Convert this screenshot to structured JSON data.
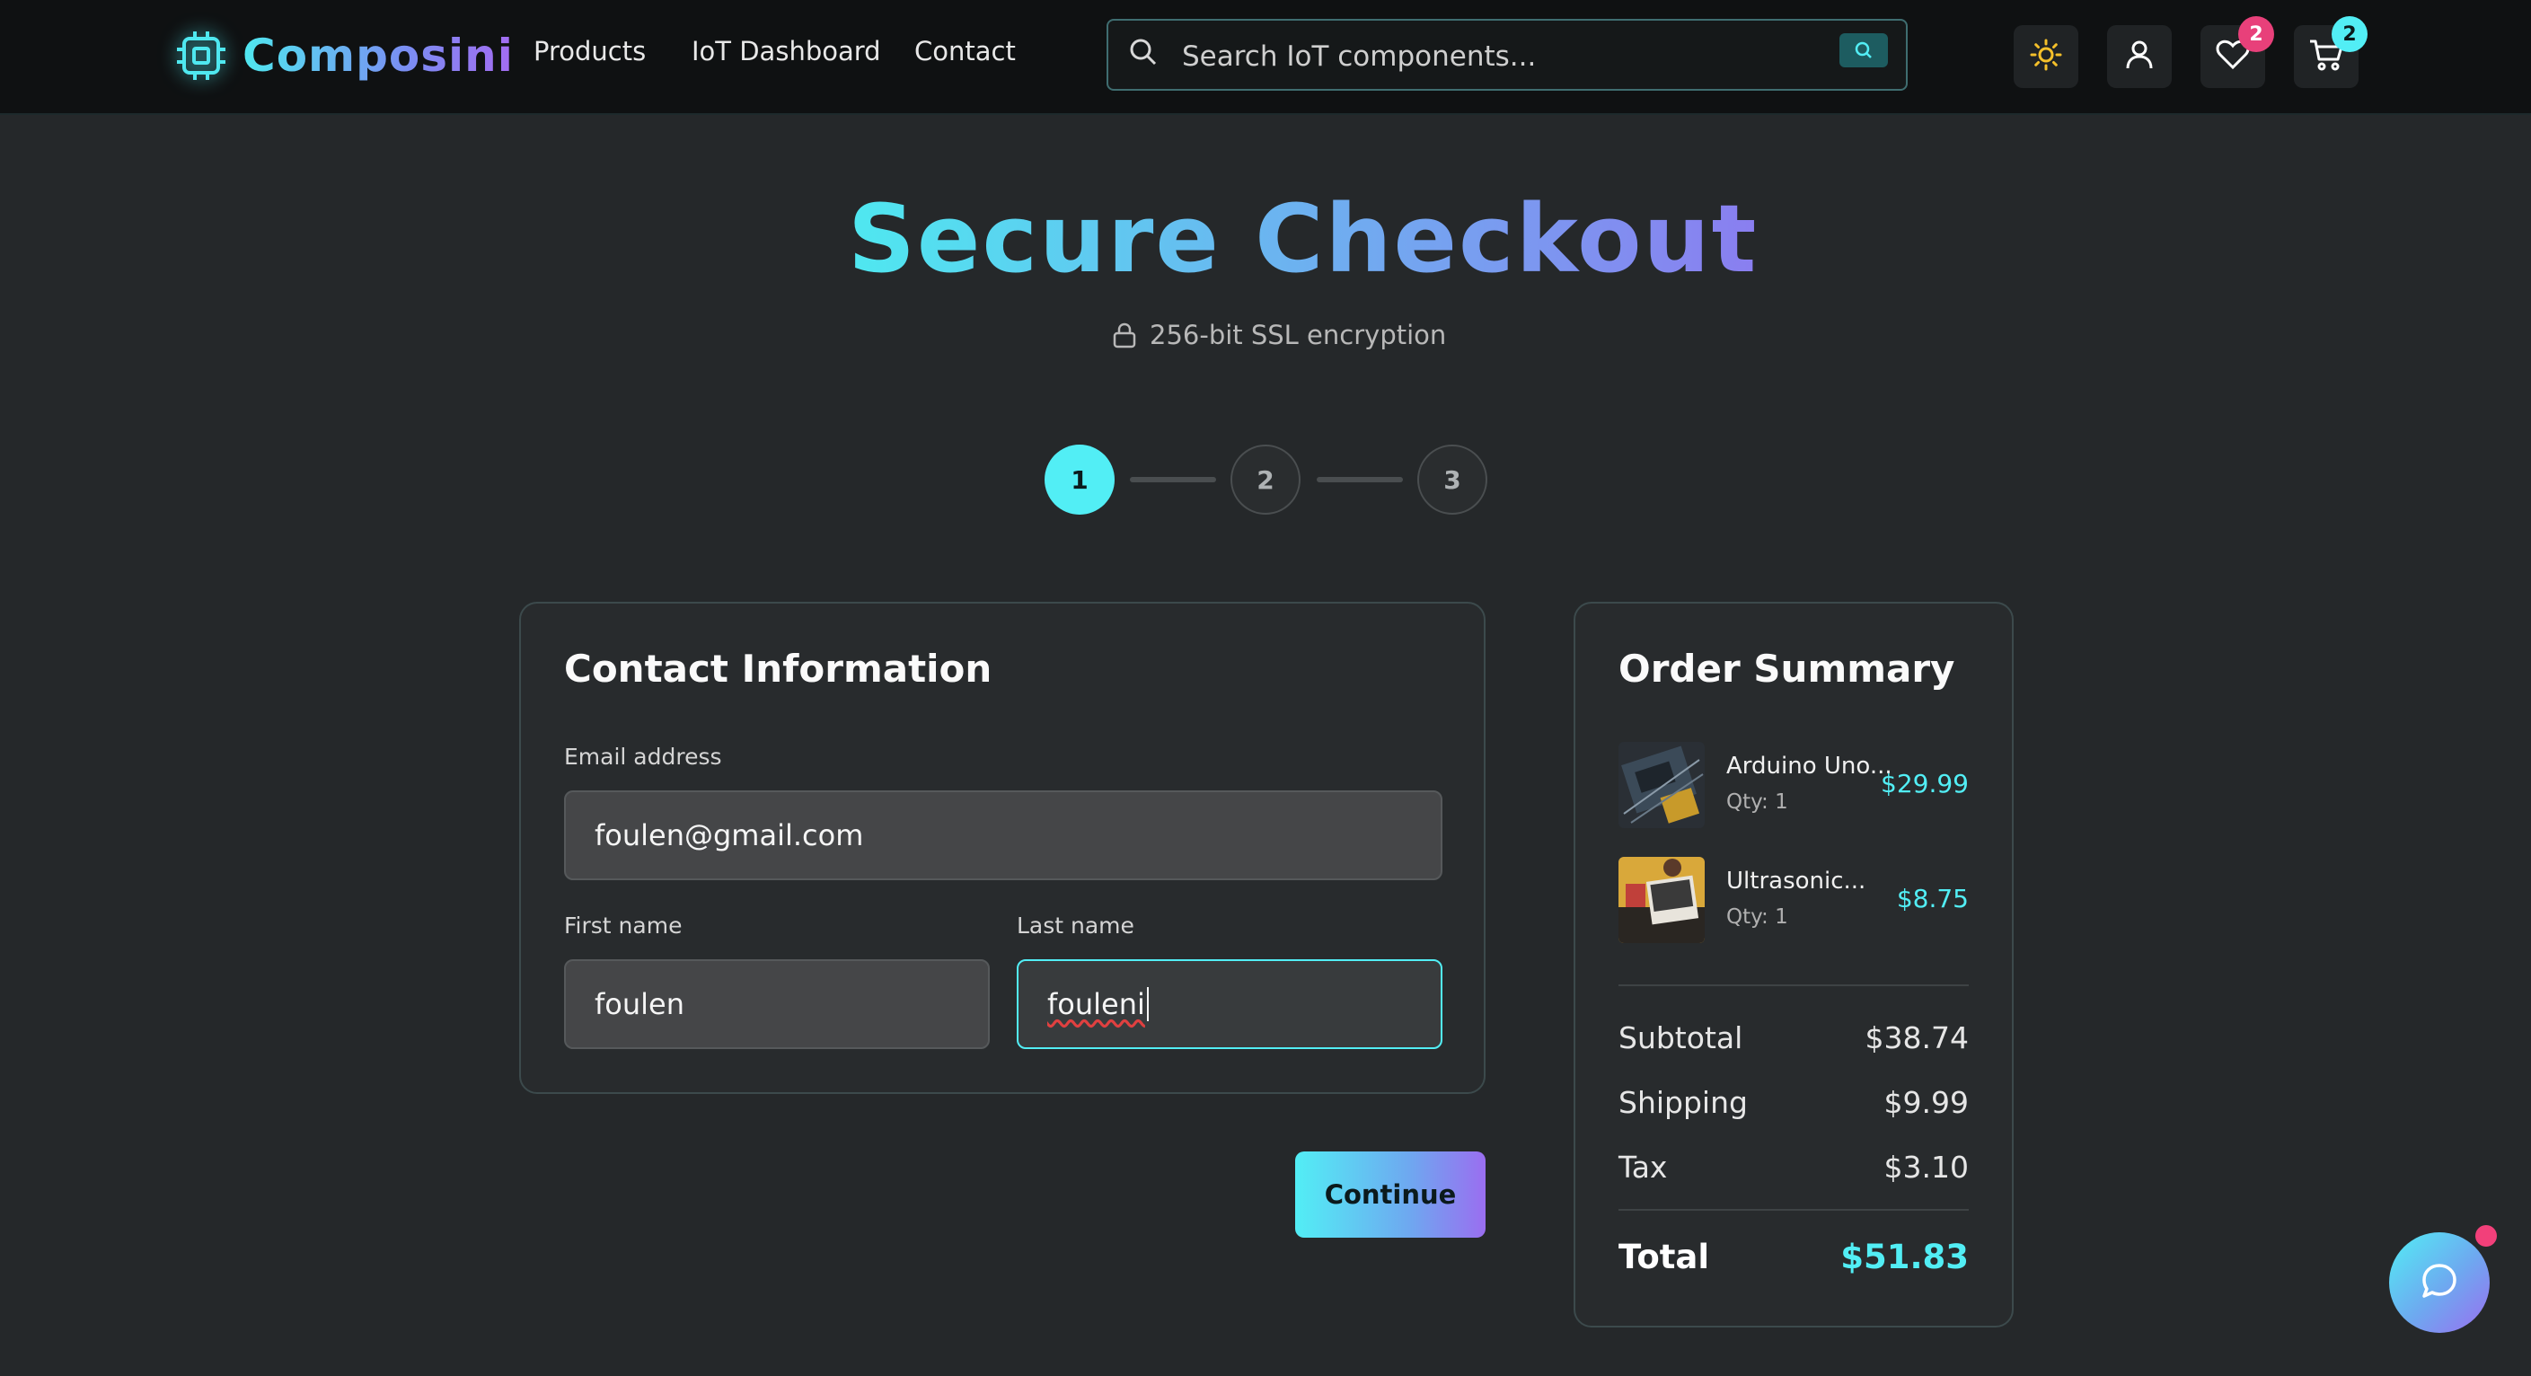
{
  "brand": {
    "name": "Composini"
  },
  "nav": {
    "products": "Products",
    "iot_dashboard": "IoT Dashboard",
    "contact": "Contact"
  },
  "search": {
    "placeholder": "Search IoT components..."
  },
  "header": {
    "wishlist_count": "2",
    "cart_count": "2"
  },
  "page": {
    "title": "Secure Checkout",
    "subtitle": "256-bit SSL encryption"
  },
  "steps": [
    {
      "label": "1",
      "active": true
    },
    {
      "label": "2",
      "active": false
    },
    {
      "label": "3",
      "active": false
    }
  ],
  "contact": {
    "title": "Contact Information",
    "email_label": "Email address",
    "email_value": "foulen@gmail.com",
    "first_name_label": "First name",
    "first_name_value": "foulen",
    "last_name_label": "Last name",
    "last_name_value": "fouleni"
  },
  "actions": {
    "continue_label": "Continue"
  },
  "order_summary": {
    "title": "Order Summary",
    "items": [
      {
        "name": "Arduino Uno...",
        "qty": "Qty: 1",
        "price": "$29.99"
      },
      {
        "name": "Ultrasonic...",
        "qty": "Qty: 1",
        "price": "$8.75"
      }
    ],
    "subtotal_label": "Subtotal",
    "subtotal_value": "$38.74",
    "shipping_label": "Shipping",
    "shipping_value": "$9.99",
    "tax_label": "Tax",
    "tax_value": "$3.10",
    "total_label": "Total",
    "total_value": "$51.83"
  },
  "colors": {
    "accent": "#52eef5",
    "accent_purple": "#9a6ef0",
    "badge_pink": "#e8407a",
    "background": "#25282a"
  }
}
